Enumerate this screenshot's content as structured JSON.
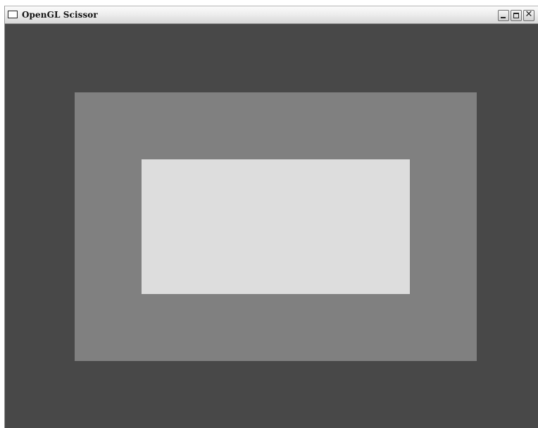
{
  "window": {
    "title": "OpenGL Scissor",
    "icon": "window-app-icon",
    "controls": {
      "minimize_icon": "minimize-icon",
      "maximize_icon": "maximize-icon",
      "close_icon": "close-icon",
      "close_glyph": "✕"
    }
  },
  "scene": {
    "background_color": "#484848",
    "outer_rect_color": "#808080",
    "inner_rect_color": "#dddddd"
  }
}
